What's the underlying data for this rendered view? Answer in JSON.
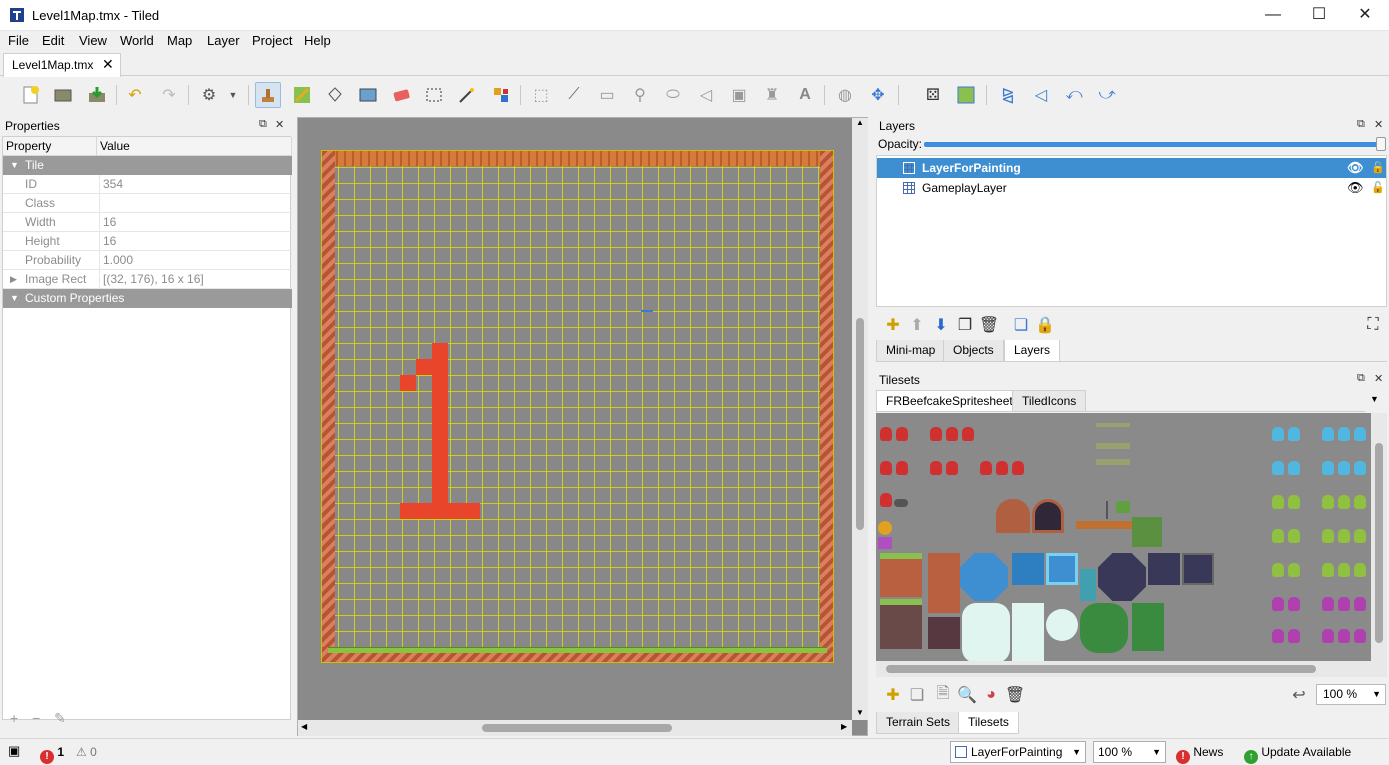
{
  "window": {
    "title": "Level1Map.tmx - Tiled",
    "minimize": "—",
    "maximize": "☐",
    "close": "✕"
  },
  "menu": [
    "File",
    "Edit",
    "View",
    "World",
    "Map",
    "Layer",
    "Project",
    "Help"
  ],
  "document_tab": {
    "label": "Level1Map.tmx",
    "close": "✕"
  },
  "toolbar_icons": [
    "new-icon",
    "open-icon",
    "save-icon",
    "undo-icon",
    "redo-icon",
    "commands-icon",
    "stamp-brush-icon",
    "terrain-brush-icon",
    "bucket-fill-icon",
    "shape-fill-icon",
    "eraser-icon",
    "rect-select-icon",
    "magic-wand-icon",
    "select-same-tile-icon",
    "select-objects-icon",
    "edit-polygons-icon",
    "insert-rectangle-icon",
    "insert-point-icon",
    "insert-ellipse-icon",
    "insert-polygon-icon",
    "insert-tile-icon",
    "insert-template-icon",
    "insert-text-icon",
    "world-tool-icon",
    "move-icon",
    "random-mode-icon",
    "wang-fill-icon",
    "flip-horizontal-icon",
    "flip-vertical-icon",
    "rotate-left-icon",
    "rotate-right-icon"
  ],
  "properties": {
    "title": "Properties",
    "col_property": "Property",
    "col_value": "Value",
    "group_tile": "Tile",
    "rows": [
      {
        "key": "ID",
        "value": "354"
      },
      {
        "key": "Class",
        "value": ""
      },
      {
        "key": "Width",
        "value": "16"
      },
      {
        "key": "Height",
        "value": "16"
      },
      {
        "key": "Probability",
        "value": "1.000"
      },
      {
        "key": "Image Rect",
        "value": "[(32, 176), 16 x 16]"
      }
    ],
    "group_custom": "Custom Properties",
    "footer": {
      "add": "+",
      "remove": "−",
      "rename": "✎"
    }
  },
  "layers": {
    "title": "Layers",
    "opacity_label": "Opacity:",
    "opacity": 1.0,
    "items": [
      {
        "name": "LayerForPainting",
        "selected": true
      },
      {
        "name": "GameplayLayer",
        "selected": false
      }
    ],
    "tabs": [
      "Mini-map",
      "Objects",
      "Layers"
    ],
    "active_tab": "Layers"
  },
  "tilesets": {
    "title": "Tilesets",
    "tabs": [
      "FRBeefcakeSpritesheet",
      "TiledIcons"
    ],
    "zoom": "100 %",
    "bottom_tabs": [
      "Terrain Sets",
      "Tilesets"
    ],
    "active_bottom_tab": "Tilesets"
  },
  "statusbar": {
    "errors": "1",
    "warnings": "0",
    "layer": "LayerForPainting",
    "zoom": "100 %",
    "news": "News",
    "update": "Update Available"
  }
}
